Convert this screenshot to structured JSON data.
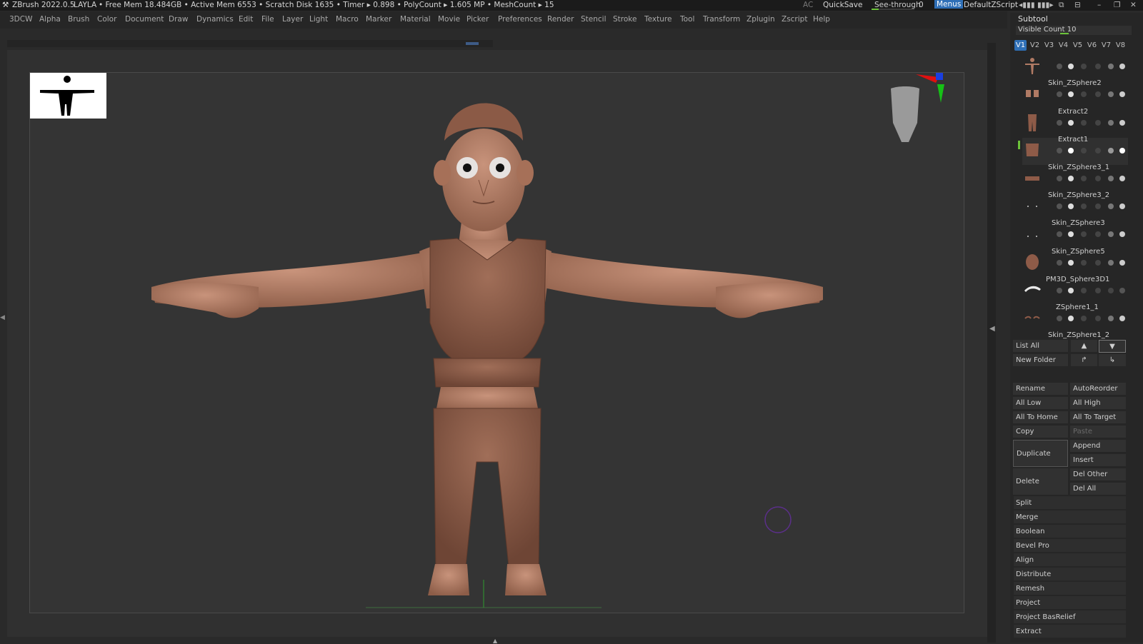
{
  "titlebar": {
    "app": "ZBrush 2022.0.5",
    "document": "LAYLA",
    "free_mem": "• Free Mem 18.484GB • Active Mem 6553 • Scratch Disk 1635 • Timer ▸ 0.898 • PolyCount ▸ 1.605 MP • MeshCount ▸ 15",
    "ac": "AC",
    "quicksave": "QuickSave",
    "see_through": "See-through",
    "see_through_value": "0",
    "menus": "Menus",
    "script": "DefaultZScript"
  },
  "menubar": [
    "3DCW",
    "Alpha",
    "Brush",
    "Color",
    "Document",
    "Draw",
    "Dynamics",
    "Edit",
    "File",
    "Layer",
    "Light",
    "Macro",
    "Marker",
    "Material",
    "Movie",
    "Picker",
    "Preferences",
    "Render",
    "Stencil",
    "Stroke",
    "Texture",
    "Tool",
    "Transform",
    "Zplugin",
    "Zscript",
    "Help"
  ],
  "subtool_panel": {
    "header": "Subtool",
    "visible_count_label": "Visible Count 10",
    "version_tabs": [
      "V1",
      "V2",
      "V3",
      "V4",
      "V5",
      "V6",
      "V7",
      "V8"
    ],
    "items": [
      {
        "name": ""
      },
      {
        "name": "Skin_ZSphere2"
      },
      {
        "name": "Extract2"
      },
      {
        "name": "Extract1"
      },
      {
        "name": "Skin_ZSphere3_1"
      },
      {
        "name": "Skin_ZSphere3_2"
      },
      {
        "name": "Skin_ZSphere3"
      },
      {
        "name": "Skin_ZSphere5"
      },
      {
        "name": "PM3D_Sphere3D1"
      },
      {
        "name": "ZSphere1_1"
      },
      {
        "name": "Skin_ZSphere1_2"
      }
    ],
    "list_all": "List All",
    "new_folder": "New Folder",
    "buttons": {
      "rename": "Rename",
      "autoreorder": "AutoReorder",
      "all_low": "All Low",
      "all_high": "All High",
      "all_to_home": "All To Home",
      "all_to_target": "All To Target",
      "copy": "Copy",
      "paste": "Paste",
      "duplicate": "Duplicate",
      "append": "Append",
      "insert": "Insert",
      "delete": "Delete",
      "del_other": "Del Other",
      "del_all": "Del All"
    },
    "sections": [
      "Split",
      "Merge",
      "Boolean",
      "Bevel Pro",
      "Align",
      "Distribute",
      "Remesh",
      "Project",
      "Project BasRelief",
      "Extract"
    ]
  },
  "colors": {
    "accent": "#2f6fb6",
    "skin": "#b07a64",
    "cloth": "#8e5b48",
    "active_green": "#6cc23a"
  }
}
